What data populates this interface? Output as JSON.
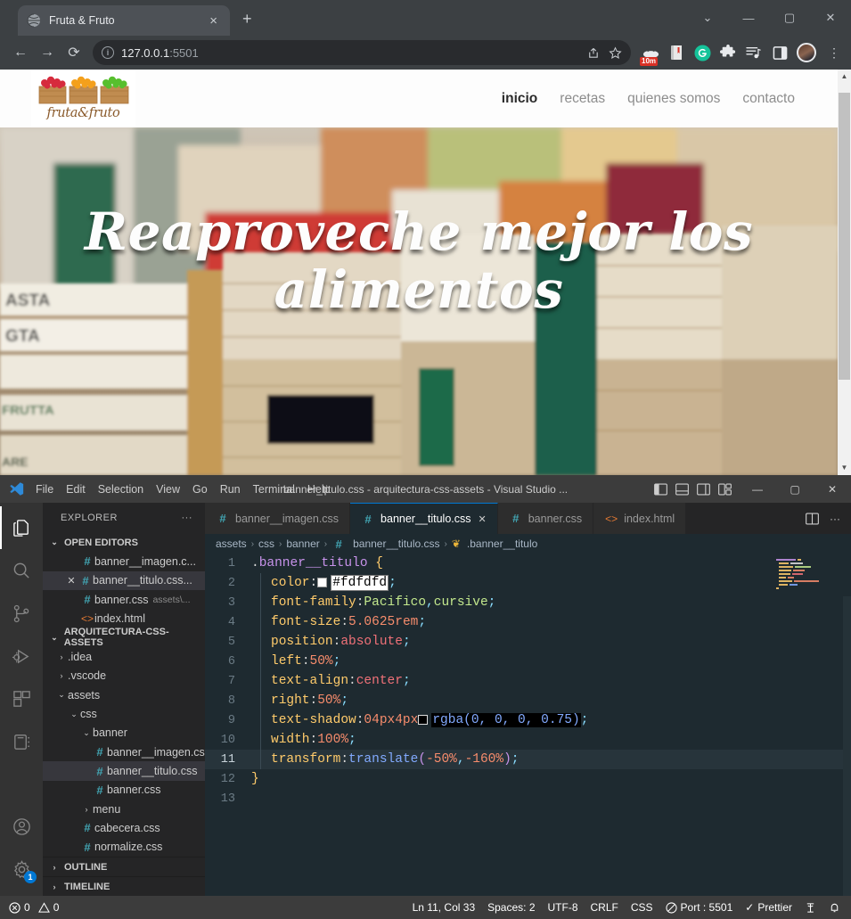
{
  "browser": {
    "tab": {
      "title": "Fruta & Fruto",
      "favicon_icon": "globe-icon",
      "close_icon": "×"
    },
    "newtab_label": "+",
    "window_controls": {
      "minimize_group": "⌄",
      "minimize": "—",
      "maximize": "▢",
      "close": "✕"
    },
    "nav": {
      "back": "←",
      "forward": "→",
      "reload": "⟳"
    },
    "omnibox": {
      "info_icon": "ⓘ",
      "url_host": "127.0.0.1",
      "url_port": ":5501",
      "share_icon": "share-icon",
      "bookmark_icon": "star-icon"
    },
    "extensions": [
      {
        "name": "timer-extension",
        "badge": "10m"
      },
      {
        "name": "dictionary-extension",
        "badge": ""
      },
      {
        "name": "grammarly-extension",
        "badge": "G"
      },
      {
        "name": "puzzle-extensions-icon",
        "badge": ""
      },
      {
        "name": "reading-list-icon",
        "badge": ""
      },
      {
        "name": "side-panel-icon",
        "badge": ""
      }
    ],
    "profile_avatar": "user-avatar",
    "menu_icon": "⋮"
  },
  "site": {
    "logo_text": "fruta&fruto",
    "nav_items": [
      {
        "label": "inicio",
        "active": true
      },
      {
        "label": "recetas",
        "active": false
      },
      {
        "label": "quienes somos",
        "active": false
      },
      {
        "label": "contacto",
        "active": false
      }
    ],
    "banner_title": "Reaproveche mejor los alimentos",
    "banner_title_color": "#fdfdfd"
  },
  "vscode": {
    "menu": [
      "File",
      "Edit",
      "Selection",
      "View",
      "Go",
      "Run",
      "Terminal",
      "Help"
    ],
    "window_title": "banner_titulo.css - arquitectura-css-assets - Visual Studio ...",
    "layout_icons": [
      "toggle-primary-sidebar-icon",
      "toggle-panel-icon",
      "toggle-secondary-sidebar-icon",
      "customize-layout-icon"
    ],
    "window_controls": {
      "minimize": "—",
      "maximize": "▢",
      "close": "✕"
    },
    "activity_bar": [
      {
        "name": "explorer-icon",
        "active": true
      },
      {
        "name": "search-icon",
        "active": false
      },
      {
        "name": "source-control-icon",
        "active": false
      },
      {
        "name": "run-and-debug-icon",
        "active": false
      },
      {
        "name": "extensions-icon",
        "active": false
      },
      {
        "name": "remote-explorer-icon",
        "active": false
      },
      {
        "name": "accounts-icon",
        "active": false
      },
      {
        "name": "settings-gear-icon",
        "active": false,
        "badge": "1"
      }
    ],
    "sidebar": {
      "title": "EXPLORER",
      "more_icon": "···",
      "open_editors": {
        "label": "OPEN EDITORS",
        "items": [
          {
            "name": "banner__imagen.c...",
            "icon": "css-file-icon",
            "path": "",
            "closeable": false,
            "selected": false
          },
          {
            "name": "banner__titulo.css...",
            "icon": "css-file-icon",
            "path": "",
            "closeable": true,
            "selected": true
          },
          {
            "name": "banner.css",
            "icon": "css-file-icon",
            "path": "assets\\...",
            "closeable": false,
            "selected": false
          },
          {
            "name": "index.html",
            "icon": "html-file-icon",
            "path": "",
            "closeable": false,
            "selected": false
          }
        ]
      },
      "project": {
        "label": "ARQUITECTURA-CSS-ASSETS",
        "tree": [
          {
            "name": ".idea",
            "type": "folder",
            "open": false,
            "depth": 1
          },
          {
            "name": ".vscode",
            "type": "folder",
            "open": false,
            "depth": 1
          },
          {
            "name": "assets",
            "type": "folder",
            "open": true,
            "depth": 1
          },
          {
            "name": "css",
            "type": "folder",
            "open": true,
            "depth": 2
          },
          {
            "name": "banner",
            "type": "folder",
            "open": true,
            "depth": 3
          },
          {
            "name": "banner__imagen.css",
            "type": "css",
            "depth": 4
          },
          {
            "name": "banner__titulo.css",
            "type": "css",
            "depth": 4,
            "selected": true
          },
          {
            "name": "banner.css",
            "type": "css",
            "depth": 4
          },
          {
            "name": "menu",
            "type": "folder",
            "open": false,
            "depth": 3
          },
          {
            "name": "cabecera.css",
            "type": "css",
            "depth": 3
          },
          {
            "name": "normalize.css",
            "type": "css",
            "depth": 3
          }
        ]
      },
      "outline_label": "OUTLINE",
      "timeline_label": "TIMELINE"
    },
    "tabs": [
      {
        "label": "banner__imagen.css",
        "icon": "css-file-icon",
        "active": false,
        "close": ""
      },
      {
        "label": "banner__titulo.css",
        "icon": "css-file-icon",
        "active": true,
        "close": "✕"
      },
      {
        "label": "banner.css",
        "icon": "css-file-icon",
        "active": false,
        "close": ""
      },
      {
        "label": "index.html",
        "icon": "html-file-icon",
        "active": false,
        "close": ""
      }
    ],
    "tab_actions": {
      "split_editor_icon": "▥",
      "more_icon": "···"
    },
    "breadcrumb": [
      "assets",
      "css",
      "banner",
      "banner__titulo.css",
      ".banner__titulo"
    ],
    "breadcrumb_file_icon": "css-file-icon",
    "breadcrumb_symbol_icon": "css-selector-icon",
    "code": {
      "lines": [
        {
          "n": "1",
          "text": ".banner__titulo {"
        },
        {
          "n": "2",
          "text": "  color: #fdfdfd;"
        },
        {
          "n": "3",
          "text": "  font-family: Pacifico, cursive;"
        },
        {
          "n": "4",
          "text": "  font-size: 5.0625rem;"
        },
        {
          "n": "5",
          "text": "  position: absolute;"
        },
        {
          "n": "6",
          "text": "  left: 50%;"
        },
        {
          "n": "7",
          "text": "  text-align: center;"
        },
        {
          "n": "8",
          "text": "  right: 50%;"
        },
        {
          "n": "9",
          "text": "  text-shadow: 0 4px 4px rgba(0, 0, 0, 0.75);"
        },
        {
          "n": "10",
          "text": "  width: 100%;"
        },
        {
          "n": "11",
          "text": "  transform: translate(-50%, -160%);"
        },
        {
          "n": "12",
          "text": "}"
        },
        {
          "n": "13",
          "text": ""
        }
      ],
      "highlighted_line": 11,
      "color_token_1": "#fdfdfd",
      "color_token_2": "rgba(0, 0, 0, 0.75)"
    },
    "status_bar": {
      "errors_icon": "error-icon",
      "errors": "0",
      "warnings_icon": "warning-icon",
      "warnings": "0",
      "position": "Ln 11, Col 33",
      "indentation": "Spaces: 2",
      "encoding": "UTF-8",
      "eol": "CRLF",
      "language": "CSS",
      "port_icon": "broadcast-icon",
      "port": "Port : 5501",
      "prettier_icon": "✓",
      "prettier": "Prettier",
      "remote_icon": "remote-icon",
      "bell_icon": "bell-icon"
    }
  }
}
